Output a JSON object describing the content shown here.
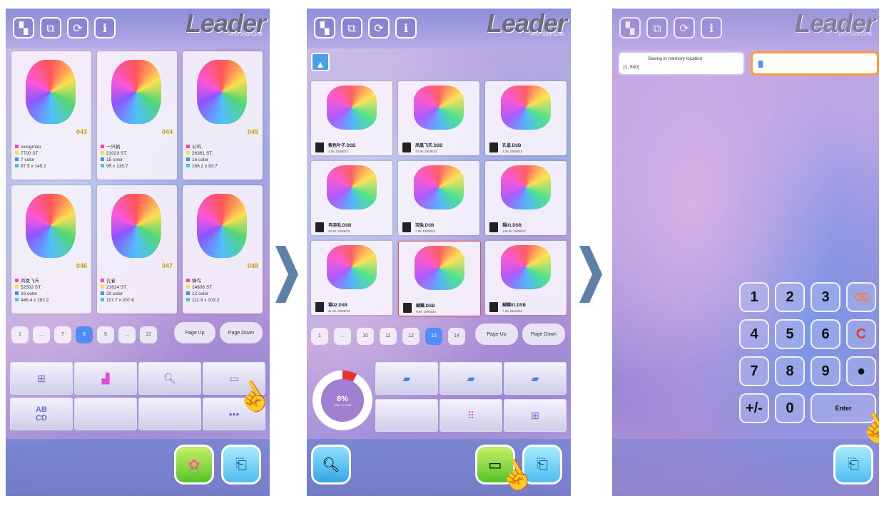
{
  "brand": {
    "logo": "Leader",
    "datetime": "14:1?  2019-12-06"
  },
  "screen1": {
    "cards": [
      {
        "num": "043",
        "name": "xiongmao",
        "stitches": "7700 ST.",
        "colors": "7 color",
        "size": "97.5 x 145.2"
      },
      {
        "num": "044",
        "name": "一只鹤",
        "stitches": "21023 ST.",
        "colors": "15 color",
        "size": "95 x 135.7"
      },
      {
        "num": "045",
        "name": "公鸡",
        "stitches": "26361 ST.",
        "colors": "16 color",
        "size": "186.2 x 93.7"
      },
      {
        "num": "046",
        "name": "凤凰飞天",
        "stitches": "52502 ST.",
        "colors": "16 color",
        "size": "446.4 x 282.2"
      },
      {
        "num": "047",
        "name": "孔雀",
        "stitches": "21624 ST.",
        "colors": "20 color",
        "size": "117.7 x 207.6"
      },
      {
        "num": "048",
        "name": "蜂鸟",
        "stitches": "14606 ST.",
        "colors": "12 color",
        "size": "111.3 x 103.2"
      }
    ],
    "pagination": [
      "1",
      "...",
      "7",
      "8",
      "9",
      "...",
      "12"
    ],
    "page_up": "Page Up",
    "page_down": "Page Down",
    "tools_more": "•••",
    "tools_abcd": "AB\nCD"
  },
  "screen2": {
    "cards": [
      {
        "name": "紫色叶子.DSB",
        "sub": "4.0K  19/08/22"
      },
      {
        "name": "凤凰飞天.DSB",
        "sub": "73.5K  19/08/22"
      },
      {
        "name": "孔雀.DSB",
        "sub": "7.2K  19/08/22"
      },
      {
        "name": "鸟羽毛.DSB",
        "sub": "30.5K  19/08/22"
      },
      {
        "name": "羽兔.DSB",
        "sub": "7.5K  19/08/22"
      },
      {
        "name": "福01.DSB",
        "sub": "148.6K  19/08/22"
      },
      {
        "name": "福02.DSB",
        "sub": "21.6K  19/08/22"
      },
      {
        "name": "蝴蝶.DSB",
        "sub": "9.0K  19/08/22"
      },
      {
        "name": "蝴蝶01.DSB",
        "sub": "7.9K  19/08/22"
      }
    ],
    "pagination": [
      "1",
      "...",
      "10",
      "11",
      "12",
      "13",
      "14"
    ],
    "page_up": "Page Up",
    "page_down": "Page Down",
    "progress": {
      "value": 0.08,
      "label": "8%",
      "sub": "64G / 3.73GB"
    }
  },
  "screen3": {
    "save_title": "Saving in memory location:",
    "save_range": "[1, 600]",
    "keys": [
      "1",
      "2",
      "3",
      "⌫",
      "4",
      "5",
      "6",
      "C",
      "7",
      "8",
      "9",
      "●",
      "+/-",
      "0",
      "Enter"
    ]
  },
  "colors": {
    "accent": "#4f8ef8",
    "progress": "#e83030",
    "input_border": "#ff9b3a"
  }
}
